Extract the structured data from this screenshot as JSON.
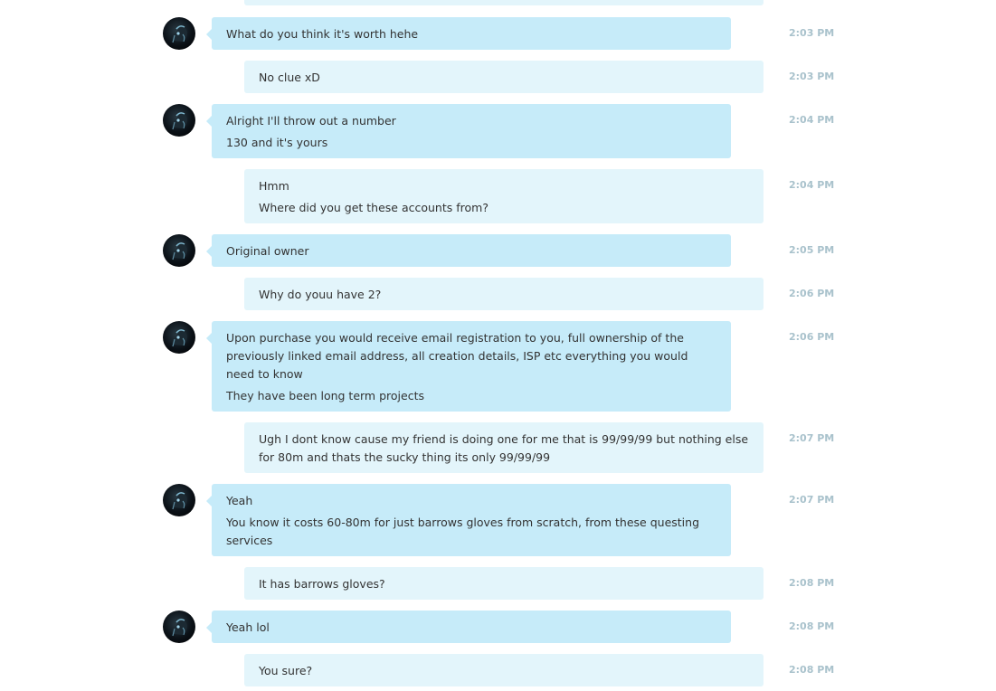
{
  "messages": [
    {
      "side": "in",
      "lines": [
        "What do you think it's worth hehe"
      ],
      "time": "2:03 PM"
    },
    {
      "side": "out",
      "lines": [
        "No clue xD"
      ],
      "time": "2:03 PM"
    },
    {
      "side": "in",
      "lines": [
        "Alright I'll throw out a number",
        "130 and it's yours"
      ],
      "time": "2:04 PM"
    },
    {
      "side": "out",
      "lines": [
        "Hmm",
        "Where did you get these accounts from?"
      ],
      "time": "2:04 PM"
    },
    {
      "side": "in",
      "lines": [
        "Original owner"
      ],
      "time": "2:05 PM"
    },
    {
      "side": "out",
      "lines": [
        "Why do youu have 2?"
      ],
      "time": "2:06 PM"
    },
    {
      "side": "in",
      "lines": [
        "Upon purchase you would receive email registration to you, full ownership of the previously linked email address, all creation details, ISP etc everything you would need to know",
        "They have been long term projects"
      ],
      "time": "2:06 PM"
    },
    {
      "side": "out",
      "lines": [
        "Ugh I dont know cause my friend is doing one for me that is 99/99/99 but nothing else for 80m and thats the sucky thing its only 99/99/99"
      ],
      "time": "2:07 PM"
    },
    {
      "side": "in",
      "lines": [
        "Yeah",
        "You know it costs 60-80m for just barrows gloves from scratch, from these questing services"
      ],
      "time": "2:07 PM"
    },
    {
      "side": "out",
      "lines": [
        "It has barrows gloves?"
      ],
      "time": "2:08 PM"
    },
    {
      "side": "in",
      "lines": [
        "Yeah lol"
      ],
      "time": "2:08 PM"
    },
    {
      "side": "out",
      "lines": [
        "You sure?"
      ],
      "time": "2:08 PM"
    }
  ]
}
